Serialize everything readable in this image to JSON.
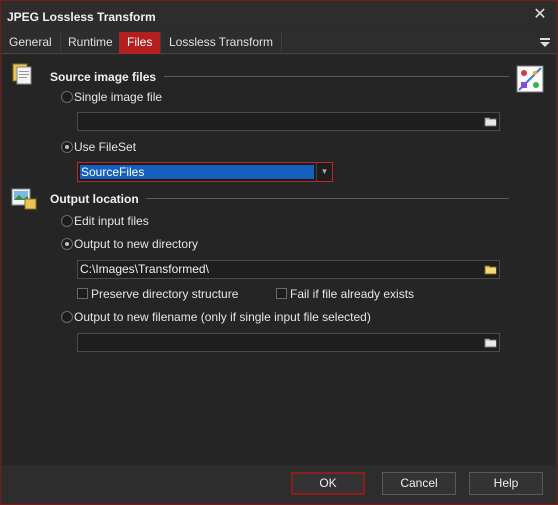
{
  "window": {
    "title": "JPEG Lossless Transform"
  },
  "tabs": [
    {
      "label": "General"
    },
    {
      "label": "Runtime"
    },
    {
      "label": "Files"
    },
    {
      "label": "Lossless Transform"
    }
  ],
  "active_tab": "Files",
  "source": {
    "title": "Source image files",
    "single_label": "Single image file",
    "single_value": "",
    "fileset_label": "Use FileSet",
    "fileset_value": "SourceFiles",
    "selected": "Use FileSet"
  },
  "output": {
    "title": "Output location",
    "edit_label": "Edit input files",
    "newdir_label": "Output to new directory",
    "directory_value": "C:\\Images\\Transformed\\",
    "preserve_label": "Preserve directory structure",
    "fail_label": "Fail if file already exists",
    "newfile_label": "Output to new filename (only if single input file selected)",
    "filename_value": "",
    "selected": "Output to new directory"
  },
  "buttons": {
    "ok": "OK",
    "cancel": "Cancel",
    "help": "Help"
  },
  "colors": {
    "accent": "#b31f1f",
    "selection": "#1560bd",
    "background": "#252525"
  },
  "icons": [
    "files-icon",
    "output-location-icon",
    "transform-graphic-icon",
    "folder-browse-icon",
    "close-icon",
    "menu-icon"
  ]
}
